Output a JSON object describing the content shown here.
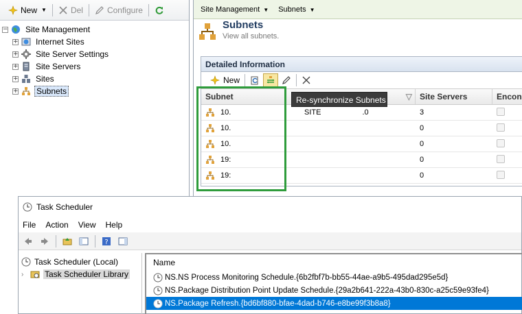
{
  "console": {
    "left_toolbar": {
      "new_label": "New",
      "del_label": "Del",
      "configure_label": "Configure"
    },
    "tree": [
      {
        "label": "Site Management",
        "level": 0,
        "icon": "globe-icon"
      },
      {
        "label": "Internet Sites",
        "level": 1,
        "icon": "web-site-icon"
      },
      {
        "label": "Site Server Settings",
        "level": 1,
        "icon": "gear-icon"
      },
      {
        "label": "Site Servers",
        "level": 1,
        "icon": "server-icon"
      },
      {
        "label": "Sites",
        "level": 1,
        "icon": "sites-icon"
      },
      {
        "label": "Subnets",
        "level": 1,
        "icon": "subnet-icon",
        "selected": true
      }
    ],
    "breadcrumb": [
      "Site Management",
      "Subnets"
    ],
    "page": {
      "title": "Subnets",
      "subtitle": "View all subnets."
    },
    "details": {
      "header": "Detailed Information",
      "new_label": "New",
      "columns": [
        "Subnet",
        "",
        "Site Servers",
        "Encon"
      ],
      "rows": [
        {
          "subnet": "10.",
          "site": "SITE",
          "extra": ".0",
          "servers": "3"
        },
        {
          "subnet": "10.",
          "site": "",
          "extra": "",
          "servers": "0"
        },
        {
          "subnet": "10.",
          "site": "",
          "extra": "",
          "servers": "0"
        },
        {
          "subnet": "19:",
          "site": "",
          "extra": "",
          "servers": "0"
        },
        {
          "subnet": "19:",
          "site": "",
          "extra": "",
          "servers": "0"
        }
      ],
      "tooltip": "Re-synchronize Subnets"
    },
    "colors": {
      "highlight": "#2e9c3b",
      "tooltip_bg": "#3b3b3b"
    }
  },
  "task_scheduler": {
    "title": "Task Scheduler",
    "menu": [
      "File",
      "Action",
      "View",
      "Help"
    ],
    "tree": [
      {
        "label": "Task Scheduler (Local)"
      },
      {
        "label": "Task Scheduler Library",
        "selected": true
      }
    ],
    "list_header": "Name",
    "items": [
      {
        "label": "NS.NS Process Monitoring Schedule.{6b2fbf7b-bb55-44ae-a9b5-495dad295e5d}"
      },
      {
        "label": "NS.Package Distribution Point Update Schedule.{29a2b641-222a-43b0-830c-a25c59e93fe4}"
      },
      {
        "label": "NS.Package Refresh.{bd6bf880-bfae-4dad-b746-e8be99f3b8a8}",
        "selected": true
      }
    ],
    "colors": {
      "selection": "#0078d7"
    }
  }
}
